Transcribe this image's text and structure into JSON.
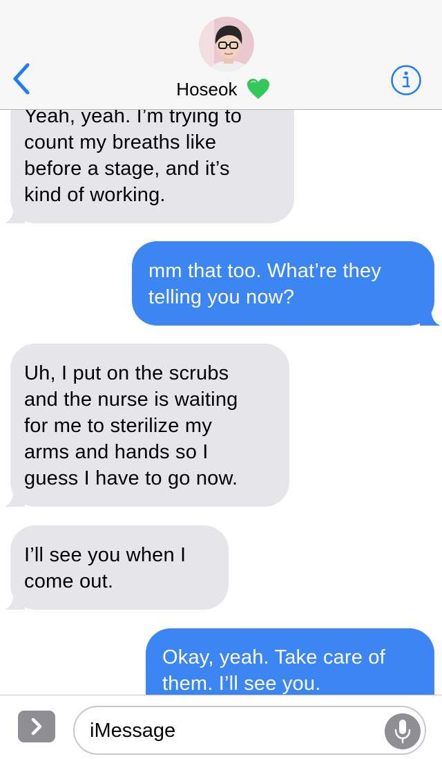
{
  "header": {
    "contact_name": "Hoseok",
    "name_emoji": "green-heart"
  },
  "messages": [
    {
      "direction": "received",
      "text": "Yeah, yeah. I’m trying to\ncount my breaths like\nbefore a stage, and it’s\nkind of working."
    },
    {
      "direction": "sent",
      "text": "mm that too. What’re they\ntelling you now?"
    },
    {
      "direction": "received",
      "text": "Uh, I put on the scrubs\nand the nurse is waiting\nfor me to sterilize my\narms and hands so I\nguess I have to go now."
    },
    {
      "direction": "received",
      "text": "I’ll see you when I\ncome out."
    },
    {
      "direction": "sent",
      "text": "Okay, yeah. Take care of\nthem. I’ll see you."
    }
  ],
  "input": {
    "placeholder": "iMessage"
  },
  "colors": {
    "sent_bubble": "#3b86f3",
    "received_bubble": "#e5e5ea",
    "accent": "#1e7cf6",
    "header_bg": "#f7f7f7",
    "heart": "#34c759"
  }
}
